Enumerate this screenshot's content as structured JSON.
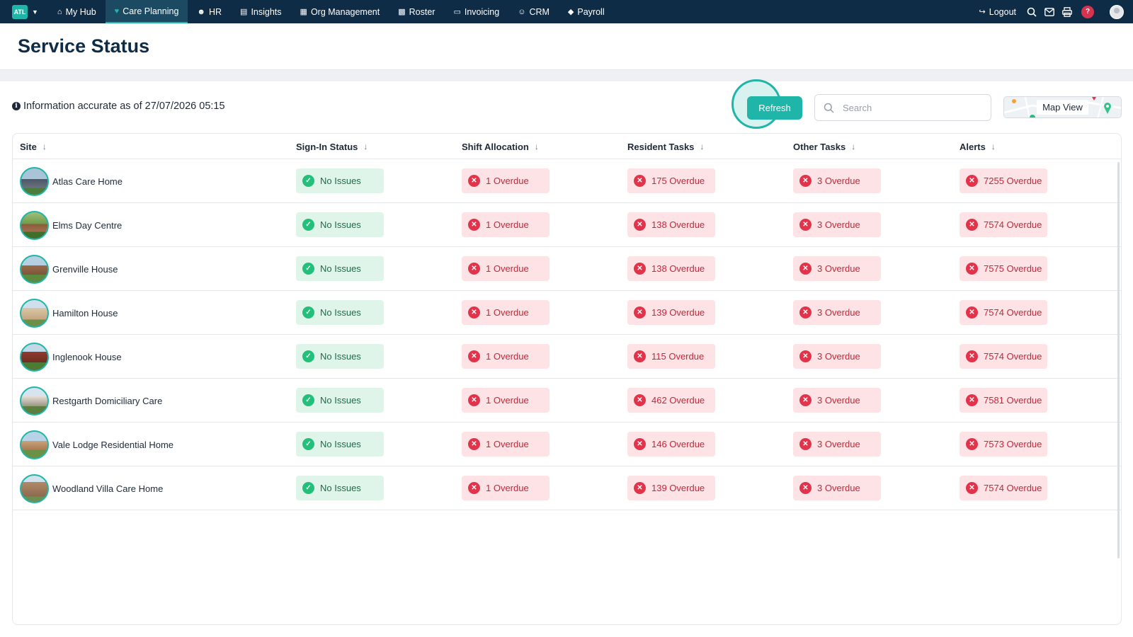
{
  "nav": {
    "logo_text": "ATL",
    "items": [
      {
        "label": "My Hub",
        "icon": "home-icon"
      },
      {
        "label": "Care Planning",
        "icon": "heart-icon"
      },
      {
        "label": "HR",
        "icon": "users-icon"
      },
      {
        "label": "Insights",
        "icon": "chart-icon"
      },
      {
        "label": "Org Management",
        "icon": "building-icon"
      },
      {
        "label": "Roster",
        "icon": "calendar-icon"
      },
      {
        "label": "Invoicing",
        "icon": "file-icon"
      },
      {
        "label": "CRM",
        "icon": "contacts-icon"
      },
      {
        "label": "Payroll",
        "icon": "tag-icon"
      }
    ],
    "active": "Care Planning",
    "logout_label": "Logout",
    "help_label": "?"
  },
  "page": {
    "title": "Service Status",
    "info_text": "Information accurate as of 27/07/2026 05:15",
    "refresh_label": "Refresh",
    "search_placeholder": "Search",
    "map_view_label": "Map View"
  },
  "table": {
    "columns": [
      "Site",
      "Sign-In Status",
      "Shift Allocation",
      "Resident Tasks",
      "Other Tasks",
      "Alerts"
    ],
    "rows": [
      {
        "site": "Atlas Care Home",
        "sign_in": "No Issues",
        "shift": "1 Overdue",
        "resident": "175 Overdue",
        "other": "3 Overdue",
        "alerts": "7255 Overdue"
      },
      {
        "site": "Elms Day Centre",
        "sign_in": "No Issues",
        "shift": "1 Overdue",
        "resident": "138 Overdue",
        "other": "3 Overdue",
        "alerts": "7574 Overdue"
      },
      {
        "site": "Grenville House",
        "sign_in": "No Issues",
        "shift": "1 Overdue",
        "resident": "138 Overdue",
        "other": "3 Overdue",
        "alerts": "7575 Overdue"
      },
      {
        "site": "Hamilton House",
        "sign_in": "No Issues",
        "shift": "1 Overdue",
        "resident": "139 Overdue",
        "other": "3 Overdue",
        "alerts": "7574 Overdue"
      },
      {
        "site": "Inglenook House",
        "sign_in": "No Issues",
        "shift": "1 Overdue",
        "resident": "115 Overdue",
        "other": "3 Overdue",
        "alerts": "7574 Overdue"
      },
      {
        "site": "Restgarth Domiciliary Care",
        "sign_in": "No Issues",
        "shift": "1 Overdue",
        "resident": "462 Overdue",
        "other": "3 Overdue",
        "alerts": "7581 Overdue"
      },
      {
        "site": "Vale Lodge Residential Home",
        "sign_in": "No Issues",
        "shift": "1 Overdue",
        "resident": "146 Overdue",
        "other": "3 Overdue",
        "alerts": "7573 Overdue"
      },
      {
        "site": "Woodland Villa Care Home",
        "sign_in": "No Issues",
        "shift": "1 Overdue",
        "resident": "139 Overdue",
        "other": "3 Overdue",
        "alerts": "7574 Overdue"
      }
    ]
  },
  "colors": {
    "nav_bg": "#0f2c47",
    "accent": "#1fb5a8",
    "ok_bg": "#dff5ea",
    "ok_text": "#1f6b46",
    "bad_bg": "#fde3e5",
    "bad_text": "#c2283a"
  }
}
